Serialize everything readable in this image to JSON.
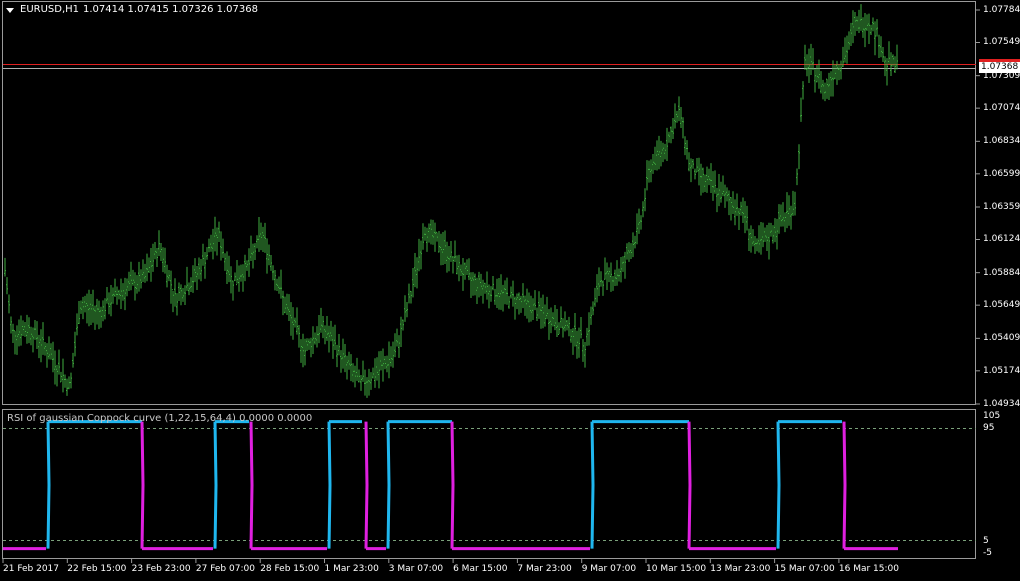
{
  "window": {
    "symbol": "EURUSD,H1",
    "ohlc": "1.07414 1.07415 1.07326 1.07368"
  },
  "price_axis": {
    "labels": [
      "1.07784",
      "1.07549",
      "1.07309",
      "1.07074",
      "1.06834",
      "1.06599",
      "1.06359",
      "1.06124",
      "1.05884",
      "1.05649",
      "1.05409",
      "1.05174",
      "1.04934"
    ],
    "bid": "1.07368"
  },
  "indicator": {
    "title": "RSI of gaussian Coppock curve (1,22,15,64,4) 0.0000 0.0000",
    "levels": [
      "105",
      "95",
      "5",
      "-5"
    ],
    "colors": {
      "up": "#1fb7ef",
      "down": "#e020e0",
      "level": "#7aa07a"
    }
  },
  "time_axis": {
    "labels": [
      "21 Feb 2017",
      "22 Feb 15:00",
      "23 Feb 23:00",
      "27 Feb 07:00",
      "28 Feb 15:00",
      "1 Mar 23:00",
      "3 Mar 07:00",
      "6 Mar 15:00",
      "7 Mar 23:00",
      "9 Mar 07:00",
      "10 Mar 15:00",
      "13 Mar 23:00",
      "15 Mar 07:00",
      "16 Mar 15:00"
    ]
  },
  "colors": {
    "background": "#000000",
    "bars": "#3fae3f",
    "bid_line": "#e02020",
    "ask_line": "#b0b0b0"
  },
  "chart_data": {
    "type": "line",
    "series": [
      {
        "x": [
          "21 Feb 2017",
          "22 Feb 15:00",
          "23 Feb 23:00",
          "27 Feb 07:00",
          "28 Feb 15:00",
          "1 Mar 23:00",
          "3 Mar 07:00",
          "6 Mar 15:00",
          "7 Mar 23:00",
          "9 Mar 07:00",
          "10 Mar 15:00",
          "13 Mar 23:00",
          "15 Mar 07:00",
          "16 Mar 15:00"
        ],
        "values": [
          1.0545,
          1.0555,
          1.0585,
          1.0598,
          1.0563,
          1.0518,
          1.06,
          1.0577,
          1.0552,
          1.0602,
          1.0665,
          1.0615,
          1.0742,
          1.074
        ]
      }
    ],
    "ylim": [
      1.04934,
      1.07784
    ]
  }
}
